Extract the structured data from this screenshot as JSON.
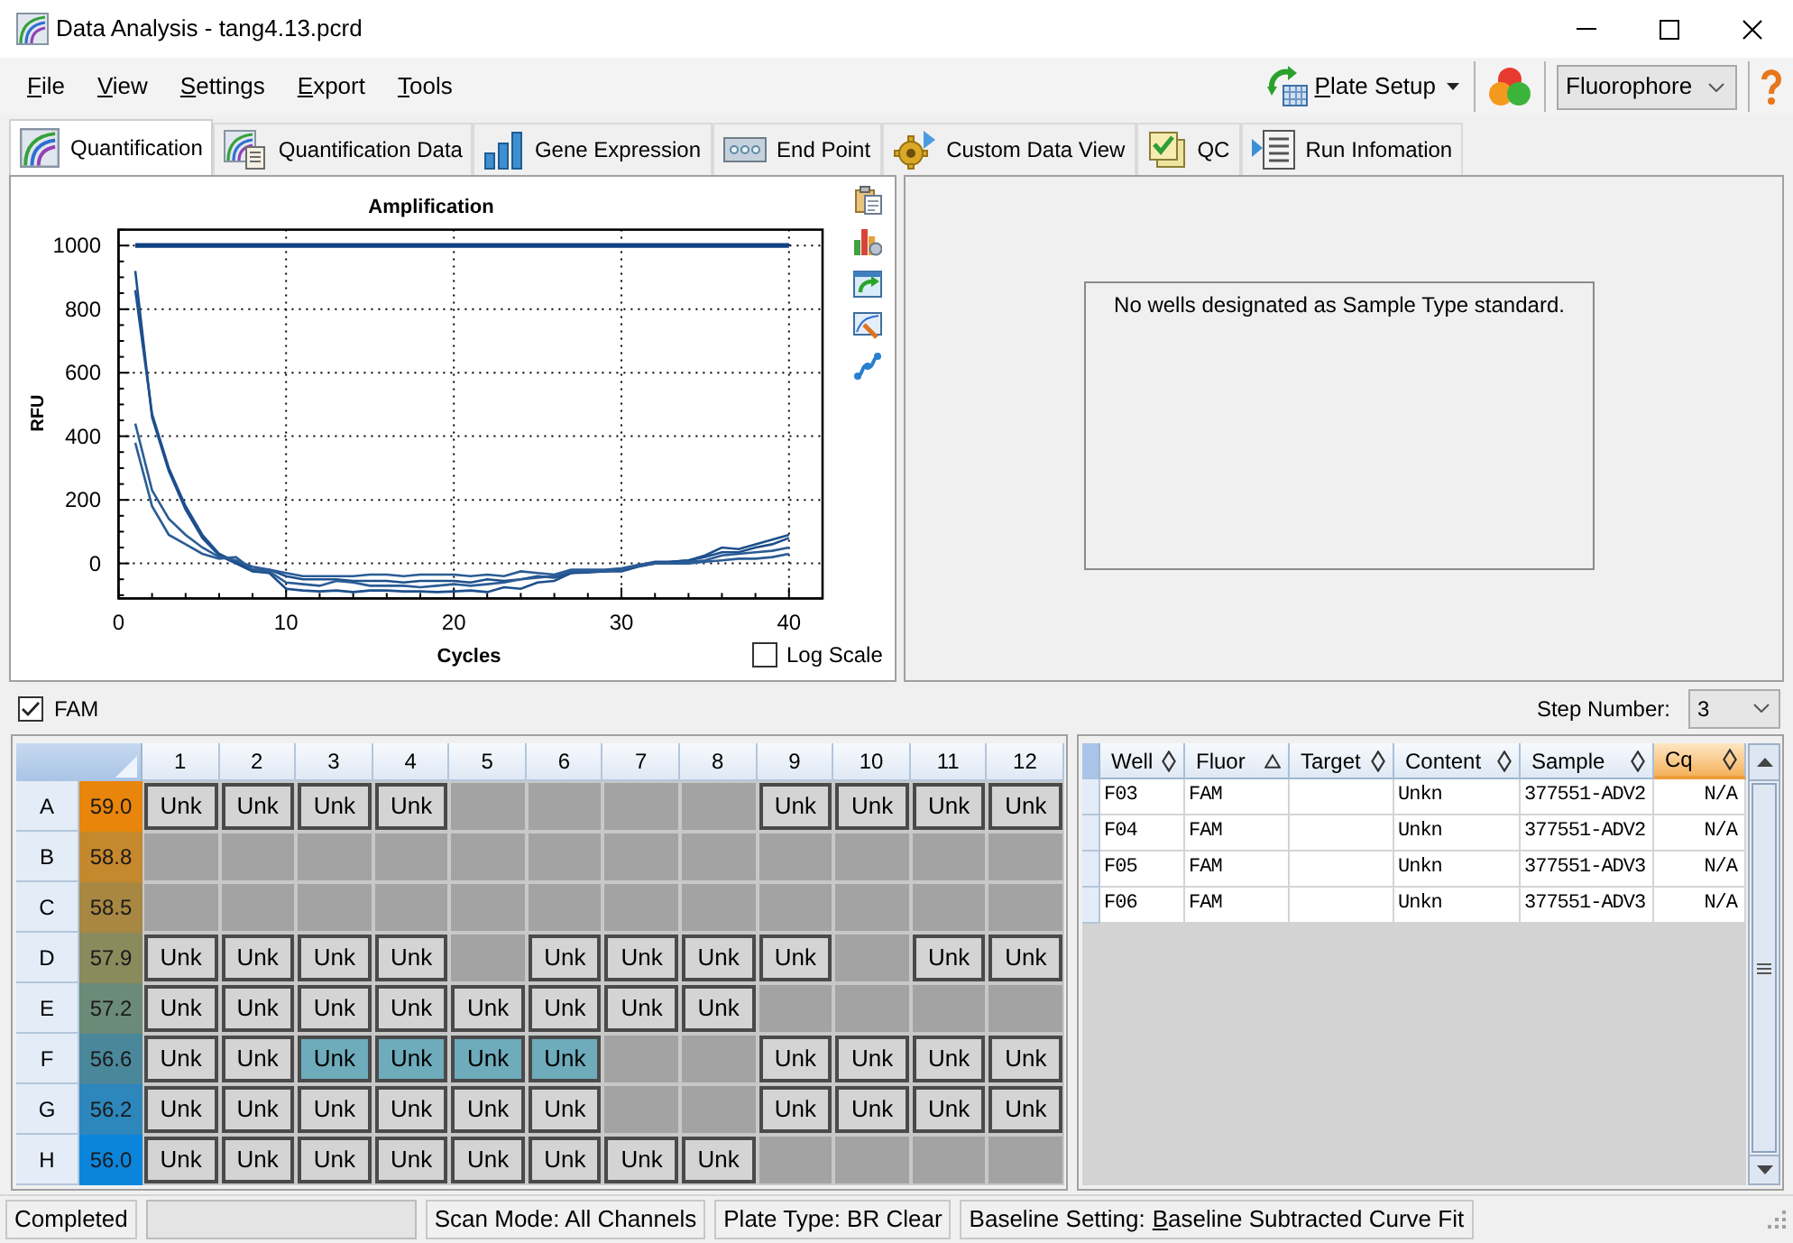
{
  "window": {
    "title": "Data Analysis - tang4.13.pcrd"
  },
  "menu": [
    "File",
    "View",
    "Settings",
    "Export",
    "Tools"
  ],
  "toolbar": {
    "plate_setup": "Plate Setup",
    "fluorophore_select": "Fluorophore"
  },
  "tabs": [
    {
      "label": "Quantification",
      "selected": true
    },
    {
      "label": "Quantification Data",
      "selected": false
    },
    {
      "label": "Gene Expression",
      "selected": false
    },
    {
      "label": "End Point",
      "selected": false
    },
    {
      "label": "Custom Data View",
      "selected": false
    },
    {
      "label": "QC",
      "selected": false
    },
    {
      "label": "Run Infomation",
      "selected": false
    }
  ],
  "chart": {
    "log_scale": {
      "label": "Log Scale",
      "checked": false
    },
    "chart_data": {
      "type": "line",
      "title": "Amplification",
      "xlabel": "Cycles",
      "ylabel": "RFU",
      "x": [
        1,
        2,
        3,
        4,
        5,
        6,
        7,
        8,
        9,
        10,
        11,
        12,
        13,
        14,
        15,
        16,
        17,
        18,
        19,
        20,
        21,
        22,
        23,
        24,
        25,
        26,
        27,
        28,
        29,
        30,
        31,
        32,
        33,
        34,
        35,
        36,
        37,
        38,
        39,
        40
      ],
      "series": [
        {
          "color": "#0d4182",
          "values": [
            1000,
            1000,
            1000,
            1000,
            1000,
            1000,
            1000,
            1000,
            1000,
            1000,
            1000,
            1000,
            1000,
            1000,
            1000,
            1000,
            1000,
            1000,
            1000,
            1000,
            1000,
            1000,
            1000,
            1000,
            1000,
            1000,
            1000,
            1000,
            1000,
            1000,
            1000,
            1000,
            1000,
            1000,
            1000,
            1000,
            1000,
            1000,
            1000,
            1000
          ]
        },
        {
          "color": "#1d4f8c",
          "values": [
            920,
            460,
            290,
            170,
            80,
            25,
            0,
            -25,
            -30,
            -80,
            -85,
            -88,
            -85,
            -90,
            -85,
            -85,
            -88,
            -88,
            -90,
            -88,
            -85,
            -90,
            -75,
            -80,
            -60,
            -55,
            -30,
            -28,
            -25,
            -20,
            -5,
            5,
            5,
            10,
            25,
            50,
            45,
            60,
            75,
            90
          ]
        },
        {
          "color": "#1d4f8c",
          "values": [
            860,
            470,
            300,
            180,
            90,
            30,
            5,
            -20,
            -20,
            -40,
            -50,
            -50,
            -50,
            -55,
            -55,
            -55,
            -60,
            -55,
            -55,
            -55,
            -60,
            -50,
            -55,
            -50,
            -40,
            -45,
            -30,
            -25,
            -25,
            -25,
            -10,
            0,
            5,
            10,
            20,
            35,
            35,
            50,
            60,
            80
          ]
        },
        {
          "color": "#2b5c96",
          "values": [
            440,
            230,
            140,
            90,
            50,
            20,
            10,
            -10,
            -20,
            -30,
            -40,
            -40,
            -40,
            -40,
            -35,
            -35,
            -40,
            -35,
            -35,
            -35,
            -40,
            -35,
            -40,
            -25,
            -30,
            -35,
            -20,
            -20,
            -20,
            -15,
            -5,
            0,
            0,
            5,
            10,
            25,
            30,
            35,
            40,
            50
          ]
        },
        {
          "color": "#2b5c96",
          "values": [
            380,
            180,
            90,
            60,
            30,
            15,
            20,
            -20,
            -25,
            -60,
            -65,
            -70,
            -55,
            -60,
            -70,
            -70,
            -70,
            -75,
            -70,
            -65,
            -70,
            -65,
            -60,
            -50,
            -45,
            -40,
            -25,
            -25,
            -25,
            -20,
            -5,
            0,
            0,
            0,
            5,
            10,
            15,
            15,
            20,
            30
          ]
        }
      ],
      "xlim": [
        0,
        42
      ],
      "ylim": [
        -110,
        1050
      ],
      "xticks": [
        0,
        10,
        20,
        30,
        40
      ],
      "yticks": [
        0,
        200,
        400,
        600,
        800,
        1000
      ],
      "grid": true
    }
  },
  "standard_curve": {
    "message": "No wells designated as Sample Type standard."
  },
  "fluor_filter": {
    "label": "FAM",
    "checked": true
  },
  "step_number": {
    "label": "Step Number:",
    "value": "3"
  },
  "plate": {
    "columns": [
      "1",
      "2",
      "3",
      "4",
      "5",
      "6",
      "7",
      "8",
      "9",
      "10",
      "11",
      "12"
    ],
    "rows": [
      {
        "label": "A",
        "temperature": "59.0",
        "color": "#e8850a",
        "wells": [
          {
            "kind": "sample",
            "label": "Unk",
            "selected": false
          },
          {
            "kind": "sample",
            "label": "Unk",
            "selected": false
          },
          {
            "kind": "sample",
            "label": "Unk",
            "selected": false
          },
          {
            "kind": "sample",
            "label": "Unk",
            "selected": false
          },
          {
            "kind": "empty",
            "selected": false
          },
          {
            "kind": "empty",
            "selected": false
          },
          {
            "kind": "empty",
            "selected": false
          },
          {
            "kind": "empty",
            "selected": false
          },
          {
            "kind": "sample",
            "label": "Unk",
            "selected": false
          },
          {
            "kind": "sample",
            "label": "Unk",
            "selected": false
          },
          {
            "kind": "sample",
            "label": "Unk",
            "selected": false
          },
          {
            "kind": "sample",
            "label": "Unk",
            "selected": false
          }
        ]
      },
      {
        "label": "B",
        "temperature": "58.8",
        "color": "#c6882c",
        "wells": [
          {
            "kind": "empty",
            "selected": false
          },
          {
            "kind": "empty",
            "selected": false
          },
          {
            "kind": "empty",
            "selected": false
          },
          {
            "kind": "empty",
            "selected": false
          },
          {
            "kind": "empty",
            "selected": false
          },
          {
            "kind": "empty",
            "selected": false
          },
          {
            "kind": "empty",
            "selected": false
          },
          {
            "kind": "empty",
            "selected": false
          },
          {
            "kind": "empty",
            "selected": false
          },
          {
            "kind": "empty",
            "selected": false
          },
          {
            "kind": "empty",
            "selected": false
          },
          {
            "kind": "empty",
            "selected": false
          }
        ]
      },
      {
        "label": "C",
        "temperature": "58.5",
        "color": "#a88742",
        "wells": [
          {
            "kind": "empty",
            "selected": false
          },
          {
            "kind": "empty",
            "selected": false
          },
          {
            "kind": "empty",
            "selected": false
          },
          {
            "kind": "empty",
            "selected": false
          },
          {
            "kind": "empty",
            "selected": false
          },
          {
            "kind": "empty",
            "selected": false
          },
          {
            "kind": "empty",
            "selected": false
          },
          {
            "kind": "empty",
            "selected": false
          },
          {
            "kind": "empty",
            "selected": false
          },
          {
            "kind": "empty",
            "selected": false
          },
          {
            "kind": "empty",
            "selected": false
          },
          {
            "kind": "empty",
            "selected": false
          }
        ]
      },
      {
        "label": "D",
        "temperature": "57.9",
        "color": "#8b8a5d",
        "wells": [
          {
            "kind": "sample",
            "label": "Unk",
            "selected": false
          },
          {
            "kind": "sample",
            "label": "Unk",
            "selected": false
          },
          {
            "kind": "sample",
            "label": "Unk",
            "selected": false
          },
          {
            "kind": "sample",
            "label": "Unk",
            "selected": false
          },
          {
            "kind": "empty",
            "selected": false
          },
          {
            "kind": "sample",
            "label": "Unk",
            "selected": false
          },
          {
            "kind": "sample",
            "label": "Unk",
            "selected": false
          },
          {
            "kind": "sample",
            "label": "Unk",
            "selected": false
          },
          {
            "kind": "sample",
            "label": "Unk",
            "selected": false
          },
          {
            "kind": "empty",
            "selected": false
          },
          {
            "kind": "sample",
            "label": "Unk",
            "selected": false
          },
          {
            "kind": "sample",
            "label": "Unk",
            "selected": false
          }
        ]
      },
      {
        "label": "E",
        "temperature": "57.2",
        "color": "#6c8a78",
        "wells": [
          {
            "kind": "sample",
            "label": "Unk",
            "selected": false
          },
          {
            "kind": "sample",
            "label": "Unk",
            "selected": false
          },
          {
            "kind": "sample",
            "label": "Unk",
            "selected": false
          },
          {
            "kind": "sample",
            "label": "Unk",
            "selected": false
          },
          {
            "kind": "sample",
            "label": "Unk",
            "selected": false
          },
          {
            "kind": "sample",
            "label": "Unk",
            "selected": false
          },
          {
            "kind": "sample",
            "label": "Unk",
            "selected": false
          },
          {
            "kind": "sample",
            "label": "Unk",
            "selected": false
          },
          {
            "kind": "empty",
            "selected": false
          },
          {
            "kind": "empty",
            "selected": false
          },
          {
            "kind": "empty",
            "selected": false
          },
          {
            "kind": "empty",
            "selected": false
          }
        ]
      },
      {
        "label": "F",
        "temperature": "56.6",
        "color": "#4b879a",
        "wells": [
          {
            "kind": "sample",
            "label": "Unk",
            "selected": false
          },
          {
            "kind": "sample",
            "label": "Unk",
            "selected": false
          },
          {
            "kind": "sample",
            "label": "Unk",
            "selected": true
          },
          {
            "kind": "sample",
            "label": "Unk",
            "selected": true
          },
          {
            "kind": "sample",
            "label": "Unk",
            "selected": true
          },
          {
            "kind": "sample",
            "label": "Unk",
            "selected": true
          },
          {
            "kind": "empty",
            "selected": false
          },
          {
            "kind": "empty",
            "selected": false
          },
          {
            "kind": "sample",
            "label": "Unk",
            "selected": false
          },
          {
            "kind": "sample",
            "label": "Unk",
            "selected": false
          },
          {
            "kind": "sample",
            "label": "Unk",
            "selected": false
          },
          {
            "kind": "sample",
            "label": "Unk",
            "selected": false
          }
        ]
      },
      {
        "label": "G",
        "temperature": "56.2",
        "color": "#2d86bc",
        "wells": [
          {
            "kind": "sample",
            "label": "Unk",
            "selected": false
          },
          {
            "kind": "sample",
            "label": "Unk",
            "selected": false
          },
          {
            "kind": "sample",
            "label": "Unk",
            "selected": false
          },
          {
            "kind": "sample",
            "label": "Unk",
            "selected": false
          },
          {
            "kind": "sample",
            "label": "Unk",
            "selected": false
          },
          {
            "kind": "sample",
            "label": "Unk",
            "selected": false
          },
          {
            "kind": "empty",
            "selected": false
          },
          {
            "kind": "empty",
            "selected": false
          },
          {
            "kind": "sample",
            "label": "Unk",
            "selected": false
          },
          {
            "kind": "sample",
            "label": "Unk",
            "selected": false
          },
          {
            "kind": "sample",
            "label": "Unk",
            "selected": false
          },
          {
            "kind": "sample",
            "label": "Unk",
            "selected": false
          }
        ]
      },
      {
        "label": "H",
        "temperature": "56.0",
        "color": "#0b85dc",
        "wells": [
          {
            "kind": "sample",
            "label": "Unk",
            "selected": false
          },
          {
            "kind": "sample",
            "label": "Unk",
            "selected": false
          },
          {
            "kind": "sample",
            "label": "Unk",
            "selected": false
          },
          {
            "kind": "sample",
            "label": "Unk",
            "selected": false
          },
          {
            "kind": "sample",
            "label": "Unk",
            "selected": false
          },
          {
            "kind": "sample",
            "label": "Unk",
            "selected": false
          },
          {
            "kind": "sample",
            "label": "Unk",
            "selected": false
          },
          {
            "kind": "sample",
            "label": "Unk",
            "selected": false
          },
          {
            "kind": "empty",
            "selected": false
          },
          {
            "kind": "empty",
            "selected": false
          },
          {
            "kind": "empty",
            "selected": false
          },
          {
            "kind": "empty",
            "selected": false
          }
        ]
      }
    ]
  },
  "well_table": {
    "columns": [
      {
        "label": "Well",
        "sorted": false,
        "highlighted": false
      },
      {
        "label": "Fluor",
        "sorted": true,
        "highlighted": false
      },
      {
        "label": "Target",
        "sorted": false,
        "highlighted": false
      },
      {
        "label": "Content",
        "sorted": false,
        "highlighted": false
      },
      {
        "label": "Sample",
        "sorted": false,
        "highlighted": false
      },
      {
        "label": "Cq",
        "sorted": false,
        "highlighted": true
      }
    ],
    "rows": [
      [
        "F03",
        "FAM",
        null,
        "Unkn",
        "377551-ADV2",
        "N/A"
      ],
      [
        "F04",
        "FAM",
        null,
        "Unkn",
        "377551-ADV2",
        "N/A"
      ],
      [
        "F05",
        "FAM",
        null,
        "Unkn",
        "377551-ADV3",
        "N/A"
      ],
      [
        "F06",
        "FAM",
        null,
        "Unkn",
        "377551-ADV3",
        "N/A"
      ]
    ]
  },
  "status_bar": [
    {
      "kind": "text",
      "text": "Completed"
    },
    {
      "kind": "progress",
      "level": 0
    },
    {
      "kind": "text",
      "text": "Scan Mode: All Channels"
    },
    {
      "kind": "text",
      "text": "Plate Type: BR Clear"
    },
    {
      "kind": "setting",
      "label": "Baseline Setting:",
      "value": "Baseline Subtracted Curve Fit"
    }
  ]
}
